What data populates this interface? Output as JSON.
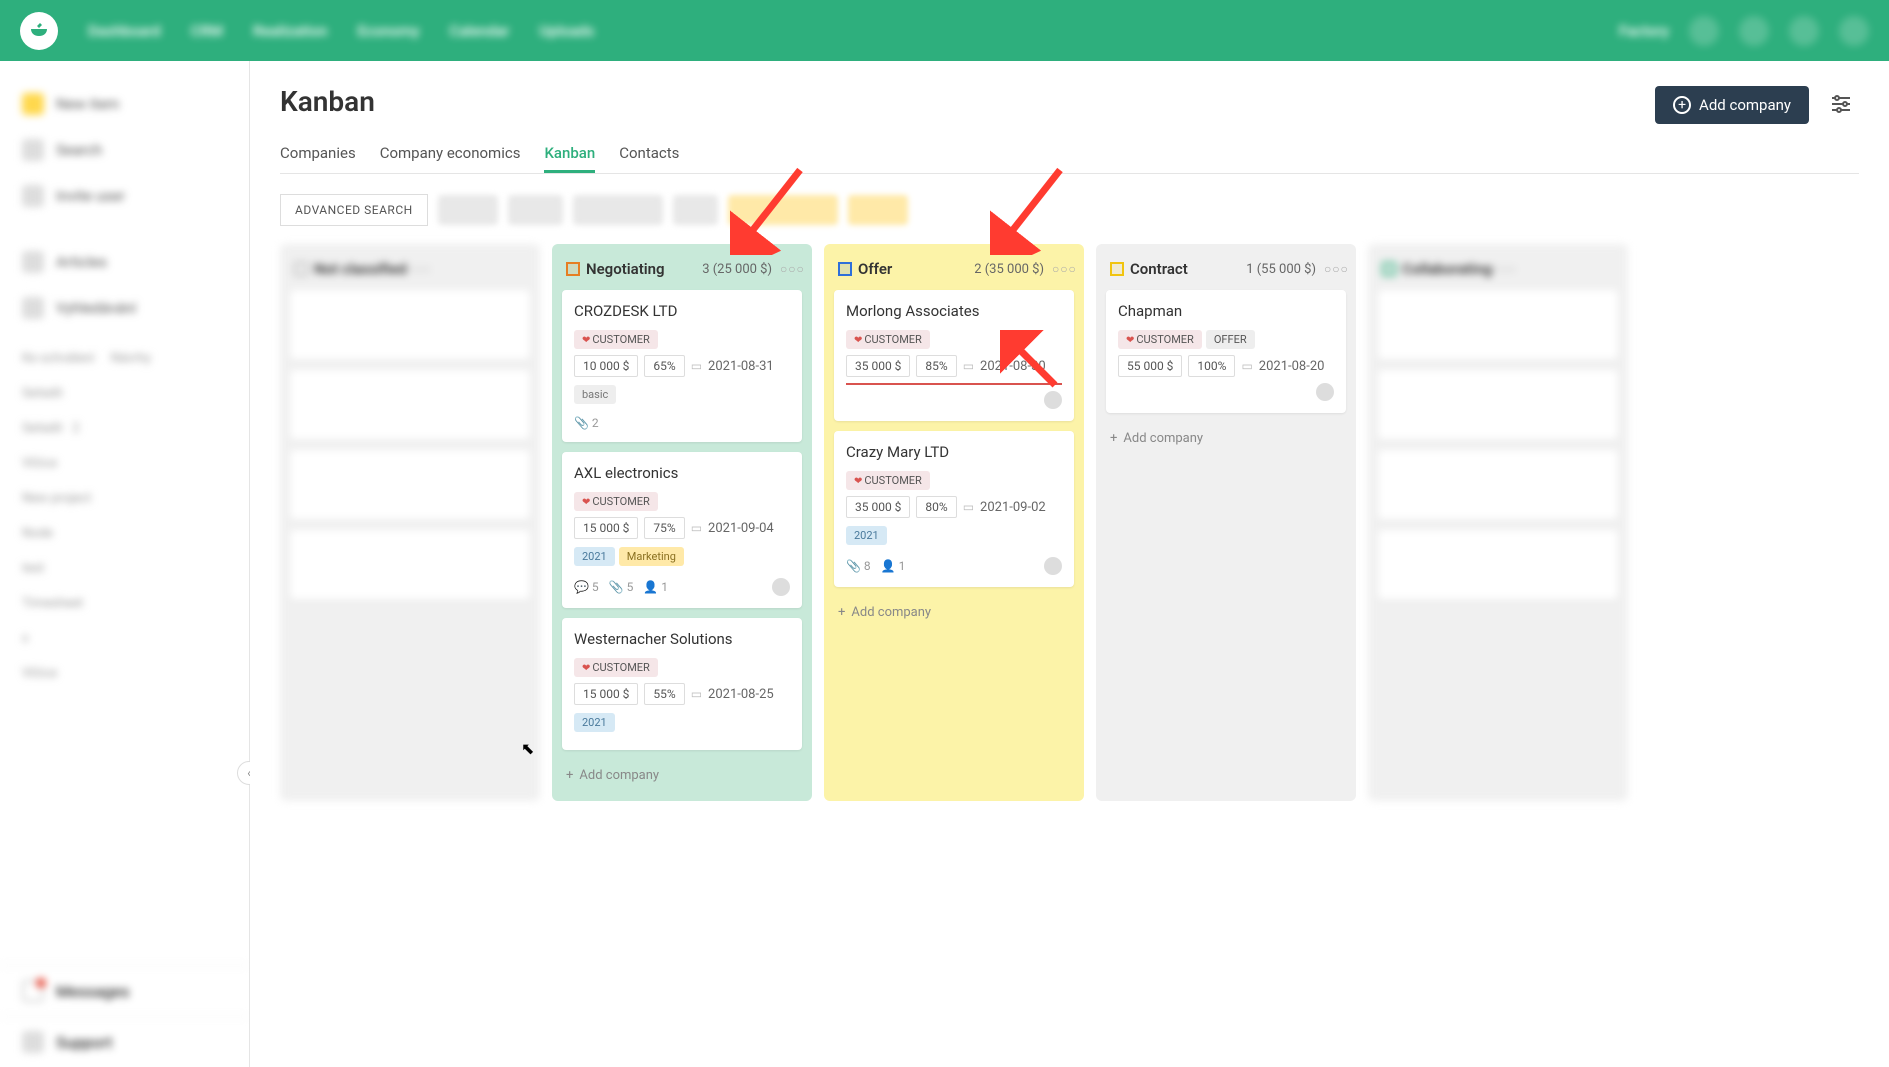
{
  "nav": {
    "links": [
      "Dashboard",
      "CRM",
      "Realization",
      "Economy",
      "Calendar",
      "Uploads"
    ],
    "right_label": "Factory"
  },
  "sidebar": {
    "new_item": "New item",
    "search": "Search",
    "invite": "Invite user",
    "articles": "Articles",
    "vyhledavani": "Vyhledávání",
    "messages": "Messages",
    "support": "Support"
  },
  "page": {
    "title": "Kanban",
    "tabs": [
      "Companies",
      "Company economics",
      "Kanban",
      "Contacts"
    ],
    "active_tab": 2,
    "add_company": "Add company",
    "advanced_search": "ADVANCED SEARCH",
    "add_company_link": "Add company"
  },
  "columns": [
    {
      "key": "not_classified",
      "title": "Not classified",
      "color": "#bbb",
      "bg": "grey",
      "blur": true,
      "cards": []
    },
    {
      "key": "negotiating",
      "title": "Negotiating",
      "summary": "3 (25 000 $)",
      "color": "#e67e22",
      "bg": "green",
      "cards": [
        {
          "title": "CROZDESK LTD",
          "tags": [
            {
              "t": "customer",
              "label": "CUSTOMER"
            }
          ],
          "amount": "10 000 $",
          "percent": "65%",
          "date": "2021-08-31",
          "extra_tags": [
            {
              "t": "basic",
              "label": "basic"
            }
          ],
          "attachments": "2"
        },
        {
          "title": "AXL electronics",
          "tags": [
            {
              "t": "customer",
              "label": "CUSTOMER"
            }
          ],
          "amount": "15 000 $",
          "percent": "75%",
          "date": "2021-09-04",
          "extra_tags": [
            {
              "t": "2021",
              "label": "2021"
            },
            {
              "t": "marketing",
              "label": "Marketing"
            }
          ],
          "comments": "5",
          "attachments": "5",
          "people": "1",
          "avatar": true
        },
        {
          "title": "Westernacher Solutions",
          "tags": [
            {
              "t": "customer",
              "label": "CUSTOMER"
            }
          ],
          "amount": "15 000 $",
          "percent": "55%",
          "date": "2021-08-25",
          "extra_tags": [
            {
              "t": "2021",
              "label": "2021"
            }
          ]
        }
      ]
    },
    {
      "key": "offer",
      "title": "Offer",
      "summary": "2 (35 000 $)",
      "color": "#2e6fd9",
      "bg": "yellow",
      "cards": [
        {
          "title": "Morlong Associates",
          "tags": [
            {
              "t": "customer",
              "label": "CUSTOMER"
            }
          ],
          "amount": "35 000 $",
          "percent": "85%",
          "date": "2021-08-30",
          "redline": true,
          "avatar": true
        },
        {
          "title": "Crazy Mary LTD",
          "tags": [
            {
              "t": "customer",
              "label": "CUSTOMER"
            }
          ],
          "amount": "35 000 $",
          "percent": "80%",
          "date": "2021-09-02",
          "extra_tags": [
            {
              "t": "2021",
              "label": "2021"
            }
          ],
          "attachments": "8",
          "people": "1",
          "avatar": true
        }
      ]
    },
    {
      "key": "contract",
      "title": "Contract",
      "summary": "1 (55 000 $)",
      "color": "#f1c40f",
      "bg": "grey",
      "cards": [
        {
          "title": "Chapman",
          "tags": [
            {
              "t": "customer",
              "label": "CUSTOMER"
            },
            {
              "t": "offer",
              "label": "OFFER"
            }
          ],
          "amount": "55 000 $",
          "percent": "100%",
          "date": "2021-08-20",
          "avatar": true
        }
      ]
    },
    {
      "key": "right_blur",
      "title": "Collaborating",
      "color": "#2eaf7d",
      "bg": "grey",
      "blur": true,
      "cards": []
    }
  ]
}
